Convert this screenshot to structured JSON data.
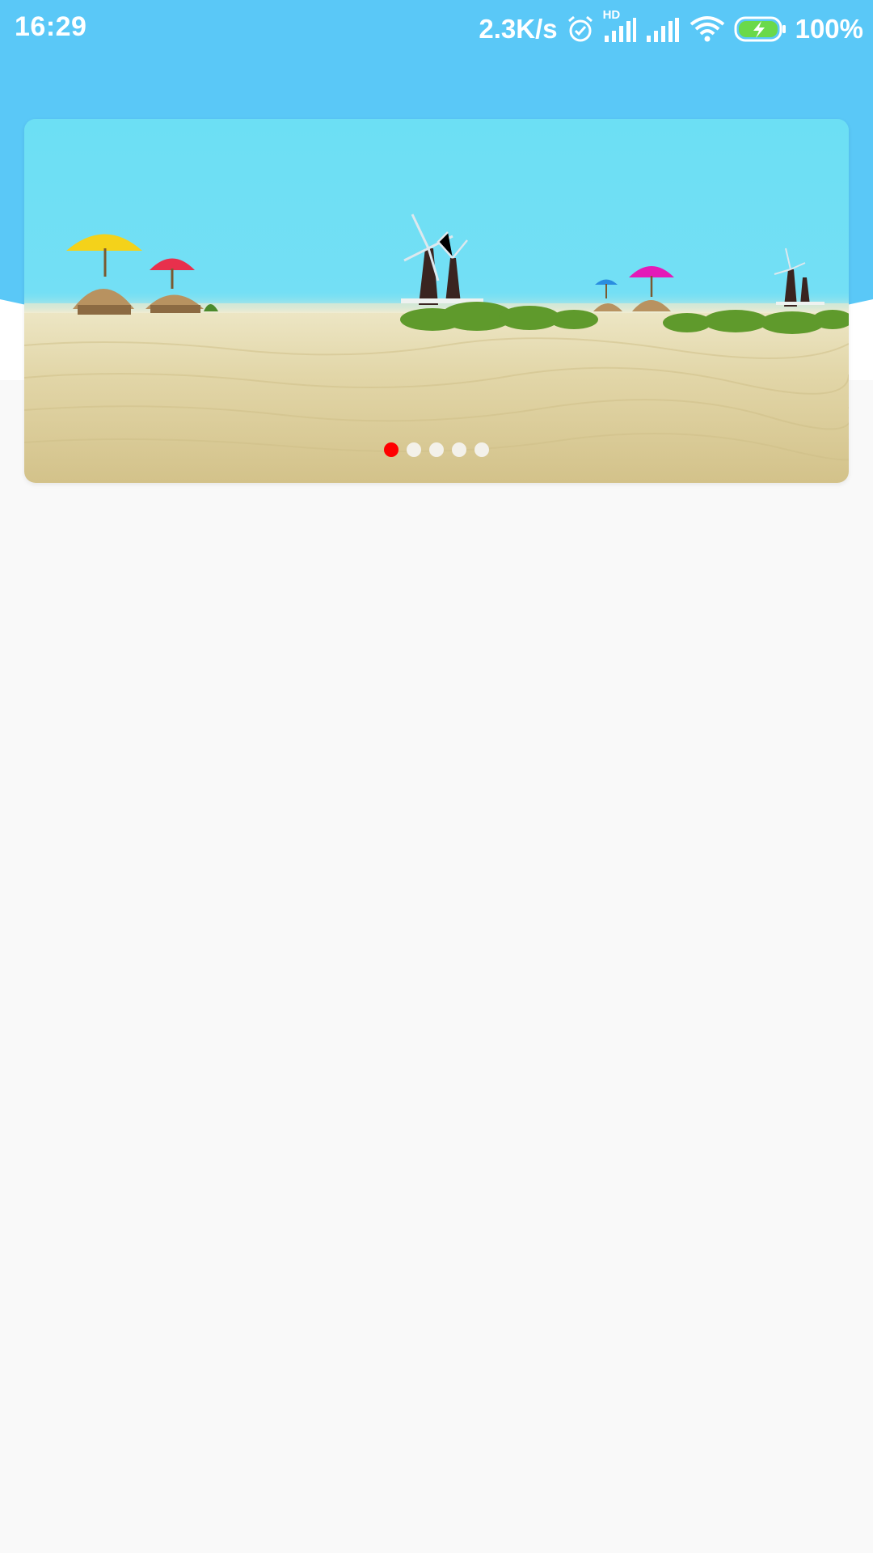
{
  "status_bar": {
    "time": "16:29",
    "network_speed": "2.3K/s",
    "hd_label": "HD",
    "battery": "100%",
    "icons": [
      "alarm-icon",
      "signal-hd-icon",
      "signal-icon",
      "wifi-icon",
      "battery-charging-icon"
    ]
  },
  "banner": {
    "image": "beach-scene-with-umbrellas-huts-and-windmills",
    "slide_count": 5,
    "active_slide": 1
  },
  "colors": {
    "header": "#5ac8f7",
    "background": "#f9f9f9",
    "indicator_active": "#ff0000",
    "indicator_inactive": "#f3f1ea"
  }
}
